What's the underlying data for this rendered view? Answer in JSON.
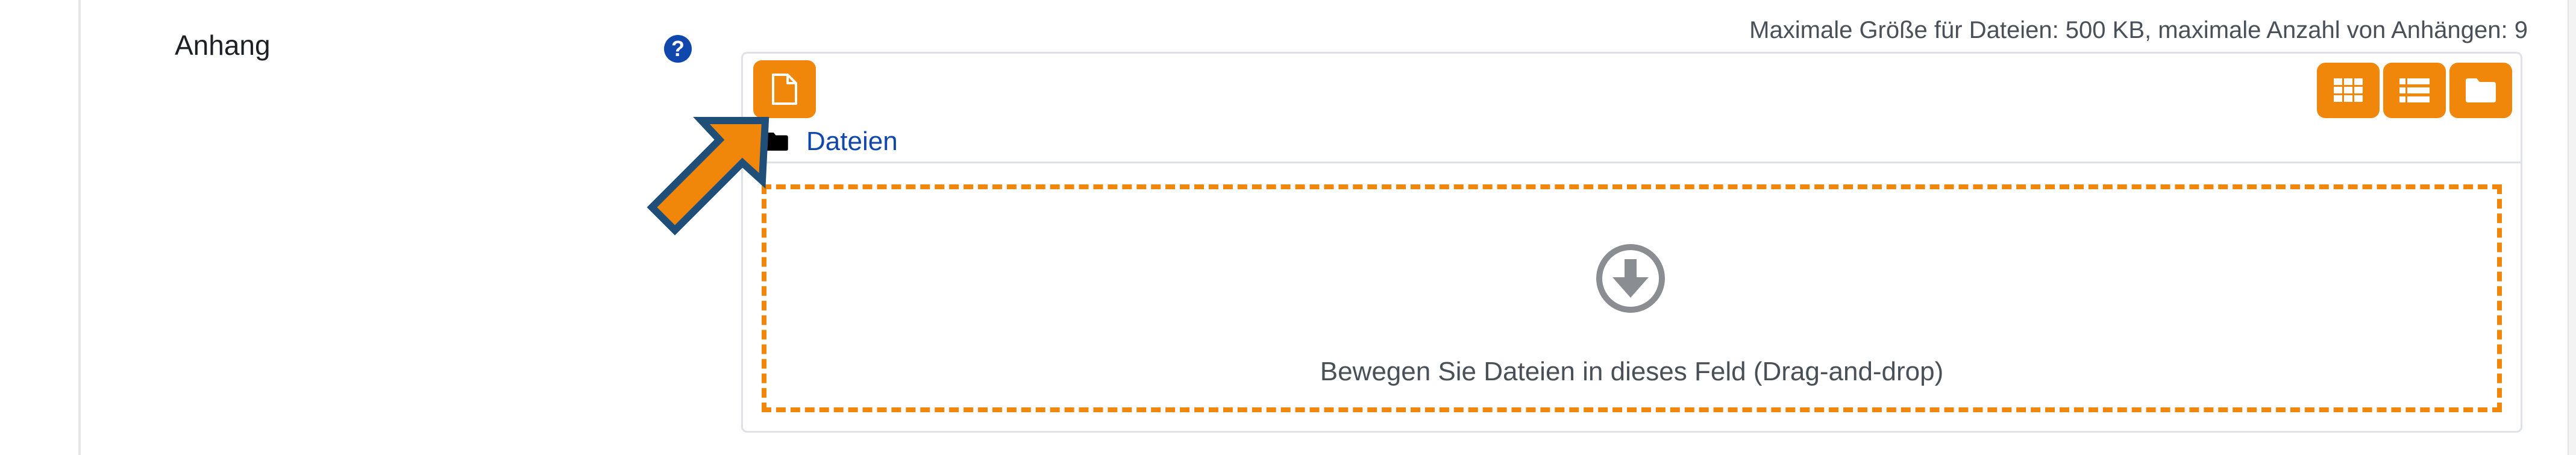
{
  "form": {
    "field_label": "Anhang",
    "help_icon": "question-circle-icon",
    "help_symbol": "?"
  },
  "filemanager": {
    "max_info": "Maximale Größe für Dateien: 500 KB, maximale Anzahl von Anhängen: 9",
    "add_file_icon": "file-add-icon",
    "view_buttons": [
      {
        "name": "view-icons",
        "icon": "grid-icon"
      },
      {
        "name": "view-list",
        "icon": "list-icon"
      },
      {
        "name": "view-tree",
        "icon": "folder-icon"
      }
    ],
    "path_folder_icon": "folder-icon",
    "path_label": "Dateien",
    "dropzone_icon": "download-circle-icon",
    "dropzone_text": "Bewegen Sie Dateien in dieses Feld (Drag-and-drop)"
  },
  "annotation": {
    "arrow_icon": "pointer-arrow-icon"
  },
  "colors": {
    "accent": "#f0860a",
    "link": "#0f47ad",
    "text": "#1d2125",
    "muted": "#495057",
    "border": "#dee2e6",
    "arrow_outline": "#1f4e79"
  }
}
